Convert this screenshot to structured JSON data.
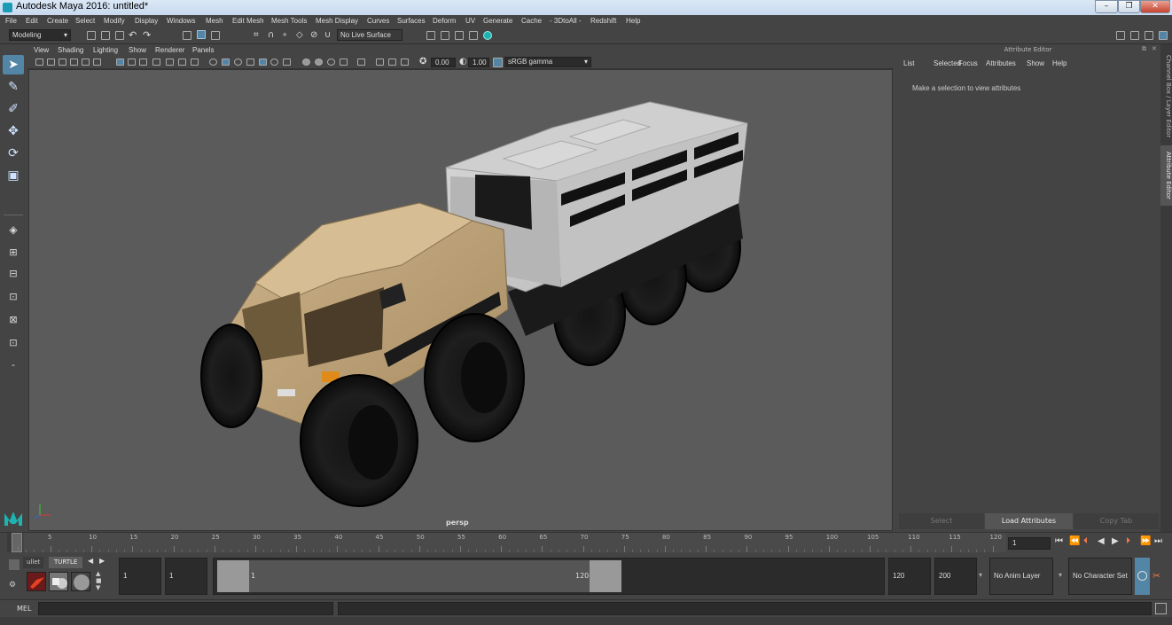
{
  "window": {
    "title": "Autodesk Maya 2016: untitled*",
    "min": "–",
    "max": "❐",
    "close": "✕"
  },
  "menus": [
    "File",
    "Edit",
    "Create",
    "Select",
    "Modify",
    "Display",
    "Windows",
    "Mesh",
    "Edit Mesh",
    "Mesh Tools",
    "Mesh Display",
    "Curves",
    "Surfaces",
    "Deform",
    "UV",
    "Generate",
    "Cache",
    "- 3DtoAll -",
    "Redshift",
    "Help"
  ],
  "status_line": {
    "mode": "Modeling",
    "live_surface": "No Live Surface"
  },
  "panel_menu": [
    "View",
    "Shading",
    "Lighting",
    "Show",
    "Renderer",
    "Panels"
  ],
  "panel_toolbar": {
    "exposure": "0.00",
    "gamma": "1.00",
    "color_space": "sRGB gamma"
  },
  "viewport": {
    "camera_label": "persp"
  },
  "attribute_editor": {
    "title": "Attribute Editor",
    "menus": [
      "List",
      "Selected",
      "Focus",
      "Attributes",
      "Show",
      "Help"
    ],
    "message": "Make a selection to view attributes",
    "buttons": {
      "select": "Select",
      "load": "Load Attributes",
      "copy": "Copy Tab"
    }
  },
  "side_tabs": {
    "channel_box": "Channel Box / Layer Editor",
    "attribute_editor": "Attribute Editor"
  },
  "timeline": {
    "ticks": [
      "1",
      "5",
      "10",
      "15",
      "20",
      "25",
      "30",
      "35",
      "40",
      "45",
      "50",
      "55",
      "60",
      "65",
      "70",
      "75",
      "80",
      "85",
      "90",
      "95",
      "100",
      "105",
      "110",
      "115",
      "120"
    ],
    "current_frame": "1",
    "playback_buttons": [
      "⏮",
      "⏪",
      "⏴",
      "◀",
      "▶",
      "⏵",
      "⏩",
      "⏭"
    ]
  },
  "range": {
    "shelf_tabs": [
      "ullet",
      "TURTLE"
    ],
    "start_frame": "1",
    "playback_start": "1",
    "slider_start": "1",
    "slider_end": "120",
    "playback_end": "120",
    "end_frame": "200",
    "anim_layer": "No Anim Layer",
    "character_set": "No Character Set"
  },
  "command_line": {
    "label": "MEL"
  },
  "colors": {
    "accent": "#5285a6",
    "viewport_bg": "#5b5b5b",
    "ui_bg": "#444444"
  }
}
